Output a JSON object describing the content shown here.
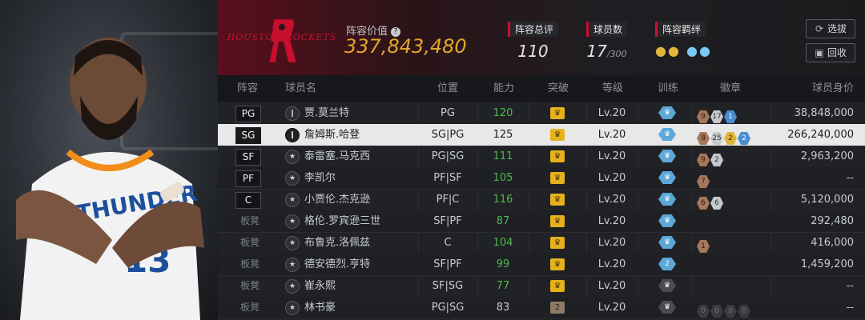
{
  "header": {
    "team_logo": "Houston Rockets logo",
    "team_name": "HOUSTON ROCKETS",
    "value_label": "阵容价值",
    "help_icon": "question-icon",
    "value": "337,843,480",
    "stats": [
      {
        "label": "阵容总评",
        "value": "110",
        "sub": ""
      },
      {
        "label": "球员数",
        "value": "17",
        "sub": "/300"
      },
      {
        "label": "阵容羁绊",
        "value": "",
        "sub": ""
      }
    ],
    "buttons": [
      {
        "label": "选拔",
        "icon": "refresh-icon"
      },
      {
        "label": "回收",
        "icon": "recycle-icon"
      }
    ]
  },
  "columns": [
    "阵容",
    "球员名",
    "位置",
    "能力",
    "突破",
    "等级",
    "训练",
    "徽章",
    "球员身价"
  ],
  "rows": [
    {
      "slot": "PG",
      "name": "贾.莫兰特",
      "pos": "PG",
      "ability": "120",
      "ab_green": true,
      "crown": "",
      "level": "Lv.20",
      "train": "",
      "badges": [
        [
          "bronze",
          "9"
        ],
        [
          "silver",
          "17"
        ],
        [
          "blue",
          "1"
        ]
      ],
      "value": "38,848,000"
    },
    {
      "slot": "SG",
      "name": "詹姆斯.哈登",
      "pos": "SG|PG",
      "ability": "125",
      "ab_green": false,
      "crown": "",
      "level": "Lv.20",
      "train": "",
      "badges": [
        [
          "bronze",
          "8"
        ],
        [
          "silver",
          "25"
        ],
        [
          "gold",
          "2"
        ],
        [
          "blue",
          "2"
        ]
      ],
      "value": "266,240,000"
    },
    {
      "slot": "SF",
      "name": "泰雷塞.马克西",
      "pos": "PG|SG",
      "ability": "111",
      "ab_green": true,
      "crown": "",
      "level": "Lv.20",
      "train": "",
      "badges": [
        [
          "bronze",
          "9"
        ],
        [
          "silver",
          "2"
        ]
      ],
      "value": "2,963,200"
    },
    {
      "slot": "PF",
      "name": "李凯尔",
      "pos": "PF|SF",
      "ability": "105",
      "ab_green": true,
      "crown": "",
      "level": "Lv.20",
      "train": "",
      "badges": [
        [
          "bronze",
          "7"
        ]
      ],
      "value": "--"
    },
    {
      "slot": "C",
      "name": "小贾伦.杰克逊",
      "pos": "PF|C",
      "ability": "116",
      "ab_green": true,
      "crown": "",
      "level": "Lv.20",
      "train": "",
      "badges": [
        [
          "bronze",
          "6"
        ],
        [
          "silver",
          "6"
        ]
      ],
      "value": "5,120,000"
    },
    {
      "slot": "板凳",
      "name": "格伦.罗宾逊三世",
      "pos": "SF|PF",
      "ability": "87",
      "ab_green": true,
      "crown": "",
      "level": "Lv.20",
      "train": "",
      "badges": [],
      "value": "292,480"
    },
    {
      "slot": "板凳",
      "name": "布鲁克.洛佩兹",
      "pos": "C",
      "ability": "104",
      "ab_green": true,
      "crown": "",
      "level": "Lv.20",
      "train": "",
      "badges": [
        [
          "bronze",
          "1"
        ]
      ],
      "value": "416,000"
    },
    {
      "slot": "板凳",
      "name": "德安德烈.亨特",
      "pos": "SF|PF",
      "ability": "99",
      "ab_green": true,
      "crown": "",
      "level": "Lv.20",
      "train": "2",
      "badges": [],
      "value": "1,459,200"
    },
    {
      "slot": "板凳",
      "name": "崔永熙",
      "pos": "SF|SG",
      "ability": "77",
      "ab_green": true,
      "crown": "",
      "level": "Lv.20",
      "train_gray": true,
      "train": "",
      "badges": [],
      "value": "--"
    },
    {
      "slot": "板凳",
      "name": "林书豪",
      "pos": "PG|SG",
      "ability": "83",
      "ab_green": false,
      "crown": "2",
      "level": "Lv.20",
      "train_gray": true,
      "train": "",
      "badges": [
        [
          "dim",
          "0"
        ],
        [
          "dim",
          "0"
        ],
        [
          "dim",
          "0"
        ],
        [
          "dim",
          "0"
        ]
      ],
      "value": "--"
    }
  ]
}
